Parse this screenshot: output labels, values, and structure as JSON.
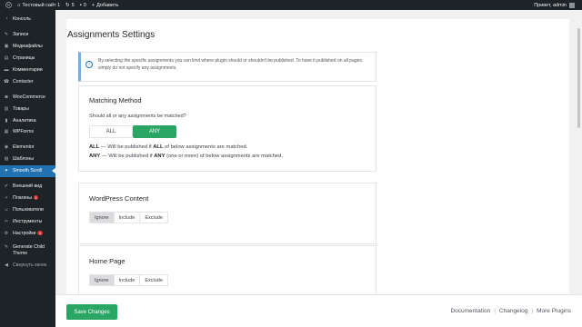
{
  "adminbar": {
    "site_name": "Тестовый сайт 1",
    "updates_count": "5",
    "comments_count": "0",
    "add_new": "Добавить",
    "greeting": "Привет, admin"
  },
  "sidebar": {
    "items": [
      {
        "label": "Консоль",
        "icon": "dashboard-icon"
      },
      {
        "label": "Записи",
        "icon": "pin-icon"
      },
      {
        "label": "Медиафайлы",
        "icon": "media-icon"
      },
      {
        "label": "Страницы",
        "icon": "page-icon"
      },
      {
        "label": "Комментарии",
        "icon": "comment-icon"
      },
      {
        "label": "Contacter",
        "icon": "contact-icon"
      },
      {
        "label": "WooCommerce",
        "icon": "woo-icon"
      },
      {
        "label": "Товары",
        "icon": "products-icon"
      },
      {
        "label": "Аналитика",
        "icon": "analytics-icon"
      },
      {
        "label": "WPForms",
        "icon": "forms-icon"
      },
      {
        "label": "Elementor",
        "icon": "elementor-icon"
      },
      {
        "label": "Шаблоны",
        "icon": "templates-icon"
      },
      {
        "label": "Smooth Scroll",
        "icon": "scroll-icon"
      },
      {
        "label": "Внешний вид",
        "icon": "appearance-icon"
      },
      {
        "label": "Плагины",
        "icon": "plugins-icon",
        "badge": "1"
      },
      {
        "label": "Пользователи",
        "icon": "users-icon"
      },
      {
        "label": "Инструменты",
        "icon": "tools-icon"
      },
      {
        "label": "Настройки",
        "icon": "settings-icon",
        "badge": "1"
      },
      {
        "label": "Generate Child Theme",
        "icon": "child-theme-icon"
      },
      {
        "label": "Свернуть меню",
        "icon": "collapse-icon"
      }
    ]
  },
  "page": {
    "title": "Assignments Settings",
    "info_text": "By selecting the specific assignments you can limit where plugin should or shouldn't be published. To have it published on all pages, simply do not specify any assignments."
  },
  "matching": {
    "title": "Matching Method",
    "question": "Should all or any assignments be matched?",
    "option_all": "ALL",
    "option_any": "ANY",
    "desc_all_key": "ALL",
    "desc_all_mid": " — Will be published if ",
    "desc_all_bold": "ALL",
    "desc_all_end": " of below assignments are matched.",
    "desc_any_key": "ANY",
    "desc_any_mid": " — Will be published if ",
    "desc_any_bold": "ANY",
    "desc_any_end": " (one or more) of below assignments are matched."
  },
  "wp_content": {
    "title": "WordPress Content",
    "ignore": "Ignore",
    "include": "Include",
    "exclude": "Exclude"
  },
  "home_page": {
    "title": "Home Page",
    "ignore": "Ignore",
    "include": "Include",
    "exclude": "Exclude"
  },
  "footer": {
    "save_label": "Save Changes",
    "documentation": "Documentation",
    "changelog": "Changelog",
    "more_plugins": "More Plugins",
    "separator": "|"
  },
  "colors": {
    "accent_green": "#2aa564",
    "current_menu": "#2271b1",
    "admin_dark": "#1d2327"
  }
}
